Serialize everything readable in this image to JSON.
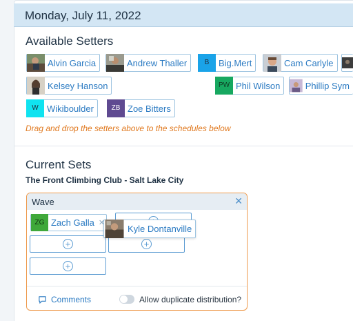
{
  "schedule": {
    "date": "Monday, July 11, 2022"
  },
  "available": {
    "title": "Available Setters",
    "setters": [
      {
        "name": "Alvin Garcia",
        "initials": "",
        "avatar": "photo"
      },
      {
        "name": "Andrew Thaller",
        "initials": "",
        "avatar": "photo"
      },
      {
        "name": "Big.Mert",
        "initials": "B",
        "avatar_color": "#1aa3e8"
      },
      {
        "name": "Cam Carlyle",
        "initials": "",
        "avatar": "photo"
      },
      {
        "name": "Kelsey Hanson",
        "initials": "",
        "avatar": "photo"
      },
      {
        "name": "Phil Wilson",
        "initials": "PW",
        "avatar_color": "#17a860"
      },
      {
        "name": "Phillip Sym",
        "initials": "",
        "avatar": "photo"
      },
      {
        "name": "Wikiboulder",
        "initials": "W",
        "avatar_color": "#10e3f0"
      },
      {
        "name": "Zoe Bitters",
        "initials": "ZB",
        "avatar_color": "#5f4a91"
      }
    ],
    "hint": "Drag and drop the setters above to the schedules below"
  },
  "current": {
    "title": "Current Sets",
    "club": "The Front Climbing Club - Salt Lake City",
    "wave": {
      "title": "Wave",
      "close_icon": "close-icon",
      "assigned": {
        "name": "Zach Galla",
        "initials": "ZG",
        "avatar_color": "#3fa83a"
      },
      "remove_icon": "close-icon",
      "comments_label": "Comments",
      "allow_label": "Allow duplicate distribution?",
      "allow_enabled": false
    },
    "dragging": {
      "name": "Kyle Dontanville",
      "avatar": "photo"
    }
  }
}
